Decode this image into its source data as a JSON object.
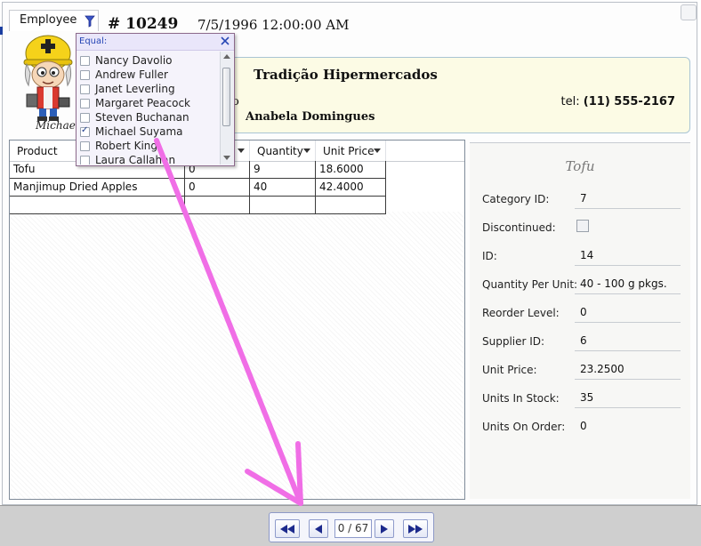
{
  "employee_header": {
    "label": "Employee"
  },
  "avatar": {
    "name": "Michael"
  },
  "order": {
    "number": "# 10249",
    "date": "7/5/1996 12:00:00 AM"
  },
  "customer": {
    "name": "Tradição Hipermercados",
    "phone_prefix": "tel:",
    "phone": "(11) 555-2167",
    "contact": "Anabela Domingues",
    "partial_text": "o"
  },
  "filter_popup": {
    "operator": "Equal:",
    "items": [
      {
        "name": "Nancy Davolio",
        "checked": false
      },
      {
        "name": "Andrew Fuller",
        "checked": false
      },
      {
        "name": "Janet Leverling",
        "checked": false
      },
      {
        "name": "Margaret Peacock",
        "checked": false
      },
      {
        "name": "Steven Buchanan",
        "checked": false
      },
      {
        "name": "Michael Suyama",
        "checked": true
      },
      {
        "name": "Robert King",
        "checked": false
      },
      {
        "name": "Laura Callahan",
        "checked": false
      }
    ]
  },
  "grid": {
    "columns": [
      "Product",
      "",
      "Quantity",
      "Unit Price"
    ],
    "rows": [
      [
        "Tofu",
        "0",
        "9",
        "18.6000"
      ],
      [
        "Manjimup Dried Apples",
        "0",
        "40",
        "42.4000"
      ],
      [
        "",
        "",
        "",
        ""
      ]
    ]
  },
  "details": {
    "title": "Tofu",
    "fields": [
      {
        "label": "Category ID:",
        "value": "7"
      },
      {
        "label": "Discontinued:",
        "value": "",
        "checkbox": true,
        "checked": false
      },
      {
        "label": "ID:",
        "value": "14"
      },
      {
        "label": "Quantity Per Unit:",
        "value": "40 - 100 g pkgs."
      },
      {
        "label": "Reorder Level:",
        "value": "0"
      },
      {
        "label": "Supplier ID:",
        "value": "6"
      },
      {
        "label": "Unit Price:",
        "value": "23.2500"
      },
      {
        "label": "Units In Stock:",
        "value": "35"
      },
      {
        "label": "Units On Order:",
        "value": "0"
      }
    ]
  },
  "pager": {
    "indicator": "0 / 67"
  },
  "colors": {
    "annotation_arrow": "#f06ee6",
    "customer_card_bg": "#fcfbe5",
    "pager_accent": "#1c2a8c"
  }
}
